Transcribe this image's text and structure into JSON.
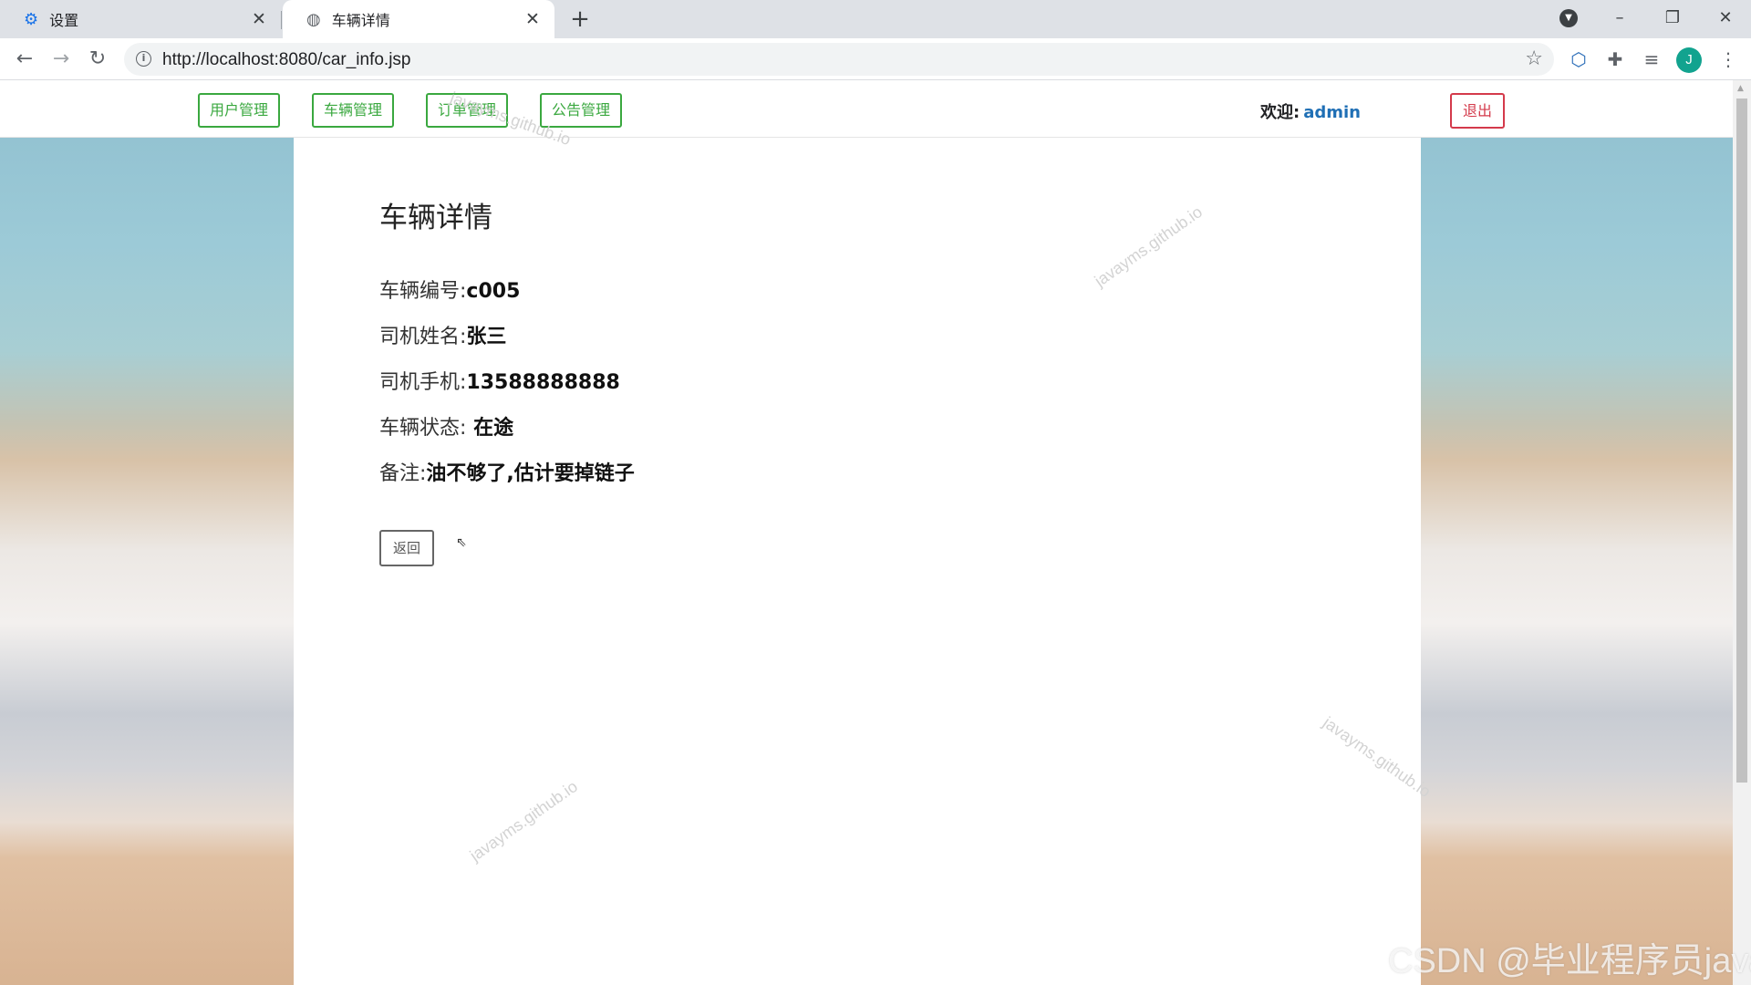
{
  "browser": {
    "tabs": [
      {
        "title": "设置",
        "icon": "gear-icon",
        "active": false
      },
      {
        "title": "车辆详情",
        "icon": "globe-icon",
        "active": true
      }
    ],
    "new_tab": "+",
    "url": "http://localhost:8080/car_info.jsp",
    "avatar_letter": "J",
    "window_controls": [
      "–",
      "❐",
      "✕"
    ]
  },
  "nav": {
    "links": [
      "用户管理",
      "车辆管理",
      "订单管理",
      "公告管理"
    ],
    "welcome_label": "欢迎:",
    "username": "admin",
    "logout": "退出",
    "accent_color": "#3aa83f",
    "danger_color": "#d43a4b"
  },
  "details": {
    "title": "车辆详情",
    "rows": [
      {
        "label": "车辆编号:",
        "value": "c005"
      },
      {
        "label": "司机姓名:",
        "value": "张三"
      },
      {
        "label": "司机手机:",
        "value": "13588888888"
      },
      {
        "label": "车辆状态:",
        "value": " 在途"
      },
      {
        "label": "备注:",
        "value": "油不够了,估计要掉链子"
      }
    ],
    "back": "返回"
  },
  "watermarks": [
    "javayms.github.io",
    "javayms.github.io",
    "javayms.github.io",
    "javayms.github.io"
  ],
  "csdn_watermark": "CSDN @毕业程序员java"
}
